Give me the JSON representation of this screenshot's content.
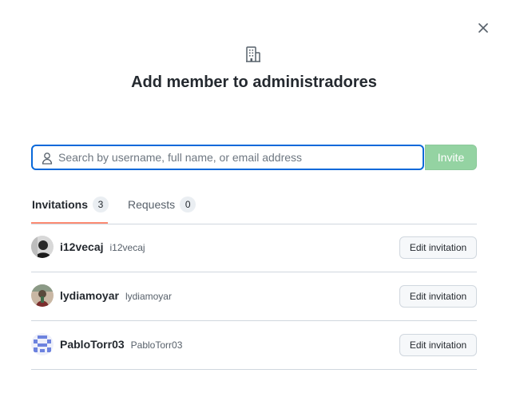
{
  "dialog": {
    "title": "Add member to administradores",
    "close_icon": "x-icon",
    "org_icon": "organization-icon"
  },
  "search": {
    "placeholder": "Search by username, full name, or email address",
    "value": "",
    "icon": "person-icon",
    "invite_label": "Invite"
  },
  "tabs": [
    {
      "label": "Invitations",
      "count": "3",
      "selected": true
    },
    {
      "label": "Requests",
      "count": "0",
      "selected": false
    }
  ],
  "invitations": [
    {
      "display_name": "i12vecaj",
      "login": "i12vecaj",
      "action_label": "Edit invitation"
    },
    {
      "display_name": "lydiamoyar",
      "login": "lydiamoyar",
      "action_label": "Edit invitation"
    },
    {
      "display_name": "PabloTorr03",
      "login": "PabloTorr03",
      "action_label": "Edit invitation"
    }
  ],
  "colors": {
    "primary_focus": "#0969da",
    "invite_disabled": "#94d3a2",
    "tab_underline": "#fd8c73",
    "border": "#d0d7de"
  }
}
